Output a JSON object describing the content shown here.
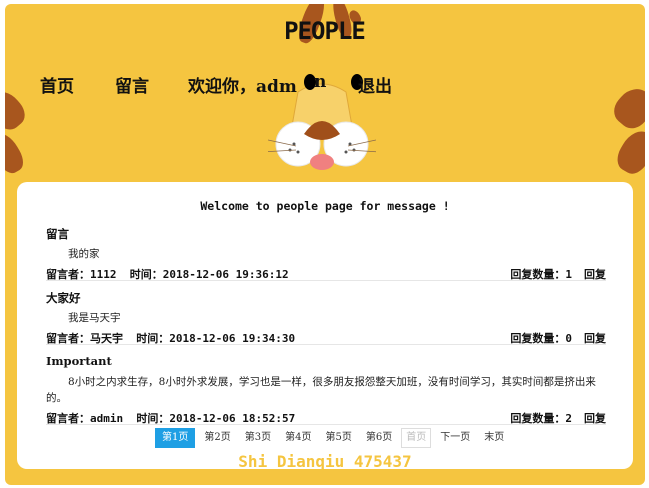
{
  "site": {
    "title": "PEOPLE"
  },
  "nav": {
    "home": "首页",
    "guestbook": "留言",
    "welcome": "欢迎你，adm",
    "username_tail": "n",
    "logout": "退出"
  },
  "welcome_text": "Welcome to people page for message !",
  "messages": [
    {
      "title": "留言",
      "content": "我的家",
      "author_label": "留言者：",
      "author": "1112",
      "time_label": "时间：",
      "time": "2018-12-06 19:36:12",
      "reply_count_label": "回复数量：",
      "reply_count": "1",
      "reply_label": "回复"
    },
    {
      "title": "大家好",
      "content": "我是马天宇",
      "author_label": "留言者：",
      "author": "马天宇",
      "time_label": "时间：",
      "time": "2018-12-06 19:34:30",
      "reply_count_label": "回复数量：",
      "reply_count": "0",
      "reply_label": "回复"
    },
    {
      "title": "Important",
      "content": "8小时之内求生存，8小时外求发展，学习也是一样，很多朋友报怨整天加班，没有时间学习，其实时间都是挤出来的。",
      "author_label": "留言者：",
      "author": "admin",
      "time_label": "时间：",
      "time": "2018-12-06 18:52:57",
      "reply_count_label": "回复数量：",
      "reply_count": "2",
      "reply_label": "回复"
    }
  ],
  "pagination": {
    "pages": [
      "第1页",
      "第2页",
      "第3页",
      "第4页",
      "第5页",
      "第6页"
    ],
    "current": "第1页",
    "first": "首页",
    "next": "下一页",
    "last": "末页"
  },
  "footer": "Shi Dianqiu 475437",
  "colors": {
    "background": "#f5c540",
    "stripe": "#a8561e",
    "accent": "#1e9fe4",
    "panel": "#ffffff"
  }
}
